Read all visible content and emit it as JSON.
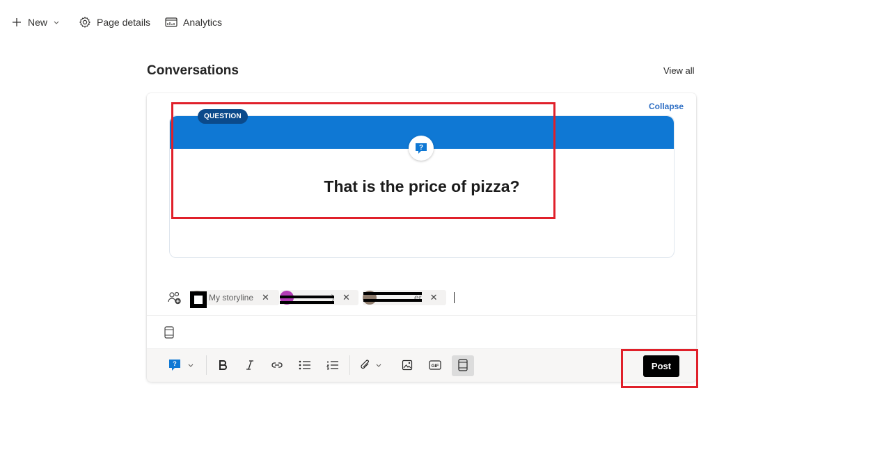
{
  "commandbar": {
    "new_label": "New",
    "page_details_label": "Page details",
    "analytics_label": "Analytics"
  },
  "section": {
    "title": "Conversations",
    "view_all": "View all"
  },
  "card": {
    "collapse": "Collapse",
    "badge": "QUESTION",
    "question": "That is the price of pizza?"
  },
  "audience": {
    "chips": [
      {
        "name": "My storyline"
      },
      {
        "name": ")"
      },
      {
        "name": "er"
      }
    ]
  },
  "toolbar": {
    "post_label": "Post"
  },
  "colors": {
    "banner": "#0f78d4",
    "badge": "#0b4a8b",
    "highlight": "#e0202a",
    "link": "#2f6fc4"
  }
}
